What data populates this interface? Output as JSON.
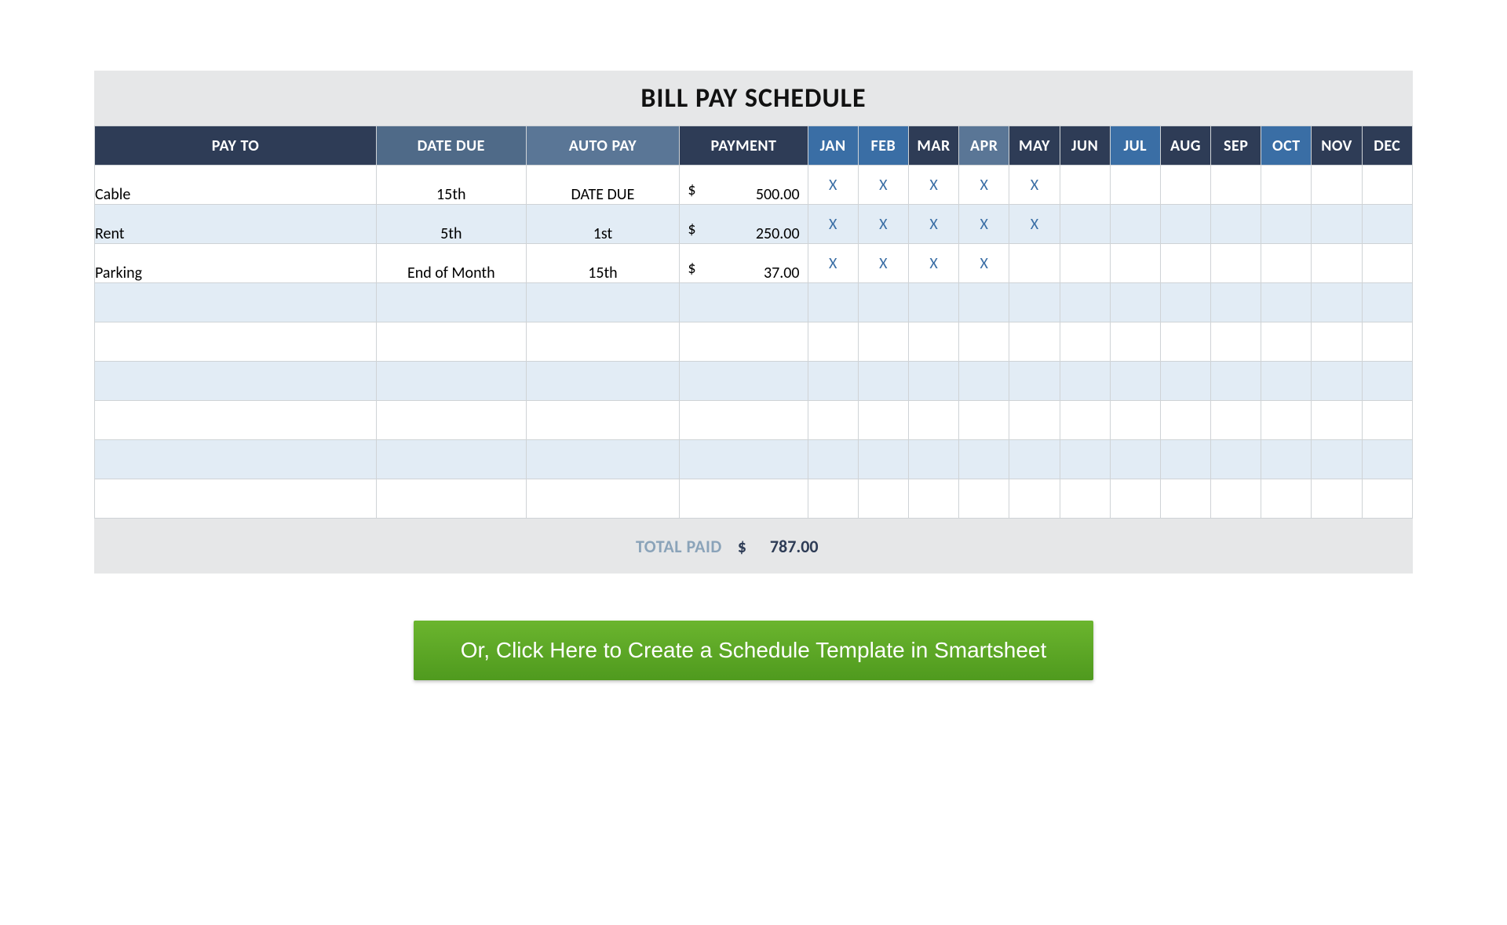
{
  "title": "BILL PAY SCHEDULE",
  "columns": {
    "payto": "PAY TO",
    "due": "DATE DUE",
    "auto": "AUTO PAY",
    "payment": "PAYMENT"
  },
  "months": [
    "JAN",
    "FEB",
    "MAR",
    "APR",
    "MAY",
    "JUN",
    "JUL",
    "AUG",
    "SEP",
    "OCT",
    "NOV",
    "DEC"
  ],
  "mark": "X",
  "currency": "$",
  "rows": [
    {
      "payto": "Cable",
      "due": "15th",
      "auto": "DATE DUE",
      "payment": "500.00",
      "marks": [
        true,
        true,
        true,
        true,
        true,
        false,
        false,
        false,
        false,
        false,
        false,
        false
      ]
    },
    {
      "payto": "Rent",
      "due": "5th",
      "auto": "1st",
      "payment": "250.00",
      "marks": [
        true,
        true,
        true,
        true,
        true,
        false,
        false,
        false,
        false,
        false,
        false,
        false
      ]
    },
    {
      "payto": "Parking",
      "due": "End of Month",
      "auto": "15th",
      "payment": "37.00",
      "marks": [
        true,
        true,
        true,
        true,
        false,
        false,
        false,
        false,
        false,
        false,
        false,
        false
      ]
    },
    {
      "payto": "",
      "due": "",
      "auto": "",
      "payment": "",
      "marks": [
        false,
        false,
        false,
        false,
        false,
        false,
        false,
        false,
        false,
        false,
        false,
        false
      ]
    },
    {
      "payto": "",
      "due": "",
      "auto": "",
      "payment": "",
      "marks": [
        false,
        false,
        false,
        false,
        false,
        false,
        false,
        false,
        false,
        false,
        false,
        false
      ]
    },
    {
      "payto": "",
      "due": "",
      "auto": "",
      "payment": "",
      "marks": [
        false,
        false,
        false,
        false,
        false,
        false,
        false,
        false,
        false,
        false,
        false,
        false
      ]
    },
    {
      "payto": "",
      "due": "",
      "auto": "",
      "payment": "",
      "marks": [
        false,
        false,
        false,
        false,
        false,
        false,
        false,
        false,
        false,
        false,
        false,
        false
      ]
    },
    {
      "payto": "",
      "due": "",
      "auto": "",
      "payment": "",
      "marks": [
        false,
        false,
        false,
        false,
        false,
        false,
        false,
        false,
        false,
        false,
        false,
        false
      ]
    },
    {
      "payto": "",
      "due": "",
      "auto": "",
      "payment": "",
      "marks": [
        false,
        false,
        false,
        false,
        false,
        false,
        false,
        false,
        false,
        false,
        false,
        false
      ]
    }
  ],
  "total": {
    "label": "TOTAL PAID",
    "currency": "$",
    "value": "787.00"
  },
  "cta": "Or, Click Here to Create a Schedule Template in Smartsheet"
}
